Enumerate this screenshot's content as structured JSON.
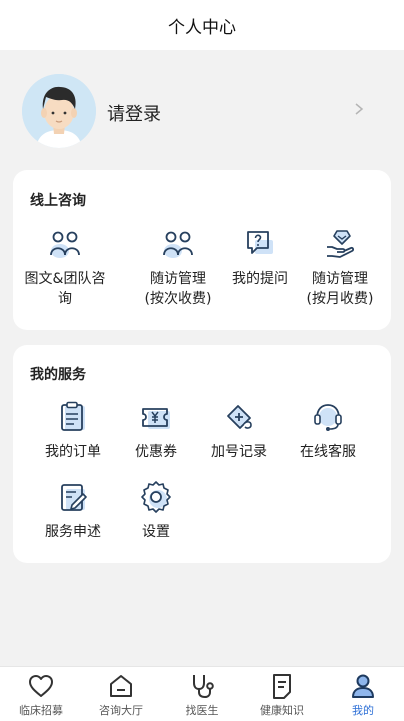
{
  "header": {
    "title": "个人中心"
  },
  "profile": {
    "login_label": "请登录"
  },
  "consult": {
    "title": "线上咨询",
    "items": [
      {
        "label": "图文&团队咨询",
        "icon": "team-consult-icon"
      },
      {
        "label": "随访管理\n(按次收费)",
        "icon": "follow-up-icon"
      },
      {
        "label": "我的提问",
        "icon": "question-icon"
      },
      {
        "label": "随访管理\n(按月收费)",
        "icon": "monthly-follow-up-icon"
      }
    ]
  },
  "services": {
    "title": "我的服务",
    "items": [
      {
        "label": "我的订单",
        "icon": "order-icon"
      },
      {
        "label": "优惠券",
        "icon": "coupon-icon"
      },
      {
        "label": "加号记录",
        "icon": "add-record-icon"
      },
      {
        "label": "在线客服",
        "icon": "customer-service-icon"
      },
      {
        "label": "服务申述",
        "icon": "service-appeal-icon"
      },
      {
        "label": "设置",
        "icon": "settings-icon"
      }
    ]
  },
  "tabbar": {
    "items": [
      {
        "label": "临床招募",
        "icon": "heart-icon"
      },
      {
        "label": "咨询大厅",
        "icon": "home-icon"
      },
      {
        "label": "找医生",
        "icon": "stethoscope-icon"
      },
      {
        "label": "健康知识",
        "icon": "document-icon"
      },
      {
        "label": "我的",
        "icon": "user-icon"
      }
    ],
    "active_color": "#2d6fd6"
  }
}
